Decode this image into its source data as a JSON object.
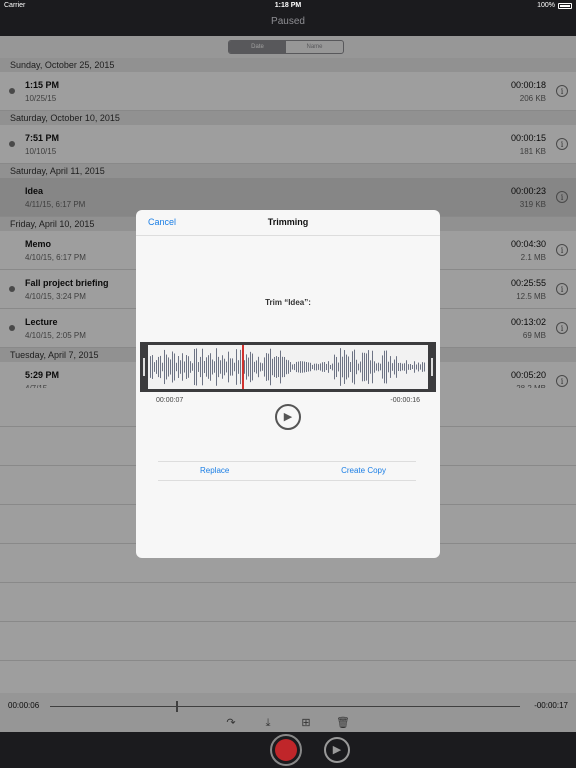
{
  "status": {
    "carrier": "Carrier",
    "time": "1:18 PM",
    "battery": "100%"
  },
  "nav": {
    "title": "Paused"
  },
  "segments": {
    "date": "Date",
    "name": "Name"
  },
  "sections": [
    {
      "header": "Sunday, October 25, 2015",
      "rows": [
        {
          "name": "1:15 PM",
          "date": "10/25/15",
          "duration": "00:00:18",
          "size": "206 KB"
        }
      ]
    },
    {
      "header": "Saturday, October 10, 2015",
      "rows": [
        {
          "name": "7:51 PM",
          "date": "10/10/15",
          "duration": "00:00:15",
          "size": "181 KB"
        }
      ]
    },
    {
      "header": "Saturday, April 11, 2015",
      "rows": [
        {
          "name": "Idea",
          "date": "4/11/15, 6:17 PM",
          "duration": "00:00:23",
          "size": "319 KB"
        }
      ]
    },
    {
      "header": "Friday, April 10, 2015",
      "rows": [
        {
          "name": "Memo",
          "date": "4/10/15, 6:17 PM",
          "duration": "00:04:30",
          "size": "2.1 MB"
        },
        {
          "name": "Fall project briefing",
          "date": "4/10/15, 3:24 PM",
          "duration": "00:25:55",
          "size": "12.5 MB"
        },
        {
          "name": "Lecture",
          "date": "4/10/15, 2:05 PM",
          "duration": "00:13:02",
          "size": "69 MB"
        }
      ]
    },
    {
      "header": "Tuesday, April 7, 2015",
      "rows": [
        {
          "name": "5:29 PM",
          "date": "4/7/15",
          "duration": "00:05:20",
          "size": "28.2 MB"
        }
      ]
    }
  ],
  "scrubber": {
    "elapsed": "00:00:06",
    "remaining": "-00:00:17"
  },
  "modal": {
    "cancel": "Cancel",
    "title": "Trimming",
    "trim_label": "Trim “Idea”:",
    "time_left": "00:00:07",
    "time_right": "-00:00:16",
    "replace": "Replace",
    "create_copy": "Create Copy"
  },
  "colors": {
    "accent": "#1a7ee5",
    "record": "#c0262a",
    "playhead": "#d0312d"
  },
  "icons": {
    "info": "info-icon",
    "share": "share-icon",
    "download": "download-icon",
    "add": "add-icon",
    "trash": "trash-icon",
    "play": "play-icon",
    "record": "record-icon"
  }
}
